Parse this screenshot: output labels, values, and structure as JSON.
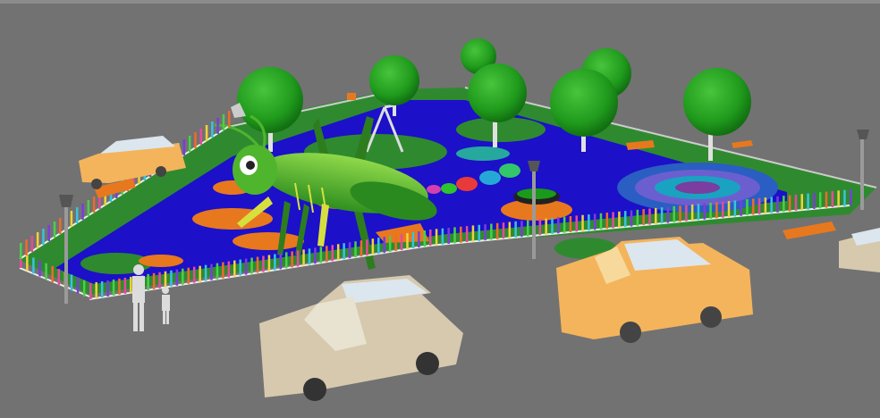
{
  "scene": {
    "kind": "3d-render",
    "subject": "playground-with-grasshopper",
    "colors": {
      "ground": "#707070",
      "rubber_surface": "#1c10c9",
      "grass": "#2f8a2f",
      "tree_canopy": "#23a21f",
      "grasshopper": "#4fb52d",
      "orange_pad": "#e8781e",
      "car_orange": "#f4b45c",
      "car_beige": "#d6c9ae",
      "car_roof": "#dce6ee",
      "figure": "#d9d9d9"
    },
    "icons": [
      "grasshopper-sculpture",
      "tree",
      "car",
      "street-lamp",
      "fence",
      "swing-set",
      "carousel",
      "bench",
      "person"
    ]
  }
}
